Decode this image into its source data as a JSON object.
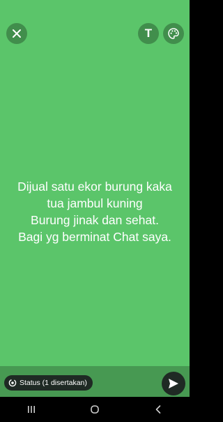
{
  "composer": {
    "background_color": "#5bc56a",
    "status_text": "Dijual satu ekor burung kaka\ntua jambul kuning\nBurung jinak dan sehat.\nBagi yg berminat Chat saya."
  },
  "toolbar": {
    "close_icon": "close-icon",
    "text_tool_label": "T",
    "palette_icon": "palette-icon"
  },
  "footer": {
    "audience_label": "Status (1 disertakan)",
    "audience_icon": "status-ring-icon",
    "send_icon": "send-icon"
  },
  "navigation": {
    "recents_icon": "recents-icon",
    "home_icon": "home-icon",
    "back_icon": "back-icon"
  }
}
